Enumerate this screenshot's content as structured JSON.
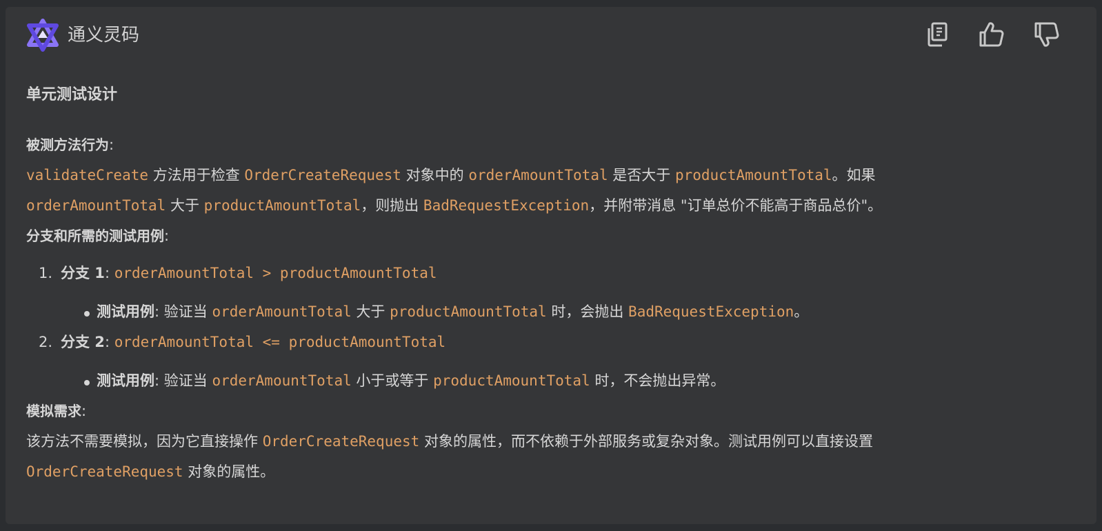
{
  "header": {
    "title": "通义灵码",
    "icons": [
      "tongyi-logo",
      "copy-icon",
      "thumbs-up-icon",
      "thumbs-down-icon"
    ]
  },
  "content": {
    "heading": "单元测试设计",
    "behavior": {
      "label": "被测方法行为",
      "colon": ":",
      "line1": {
        "c1": "validateCreate",
        "t1": " 方法用于检查 ",
        "c2": "OrderCreateRequest",
        "t2": " 对象中的 ",
        "c3": "orderAmountTotal",
        "t3": " 是否大于 ",
        "c4": "productAmountTotal",
        "t4": "。如果"
      },
      "line2": {
        "c1": "orderAmountTotal",
        "t1": " 大于 ",
        "c2": "productAmountTotal",
        "t2": "，则抛出 ",
        "c3": "BadRequestException",
        "t3": "，并附带消息 \"订单总价不能高于商品总价\"。"
      }
    },
    "branches": {
      "label": "分支和所需的测试用例",
      "colon": ":",
      "items": [
        {
          "num": "1.",
          "title": "分支 1",
          "colon": ": ",
          "expr": "orderAmountTotal > productAmountTotal",
          "case_label": "测试用例",
          "case_colon": ": ",
          "t1": "验证当 ",
          "c1": "orderAmountTotal",
          "t2": " 大于 ",
          "c2": "productAmountTotal",
          "t3": " 时，会抛出 ",
          "c3": "BadRequestException",
          "t4": "。"
        },
        {
          "num": "2.",
          "title": "分支 2",
          "colon": ": ",
          "expr": "orderAmountTotal <= productAmountTotal",
          "case_label": "测试用例",
          "case_colon": ": ",
          "t1": "验证当 ",
          "c1": "orderAmountTotal",
          "t2": " 小于或等于 ",
          "c2": "productAmountTotal",
          "t3": " 时，不会抛出异常。"
        }
      ]
    },
    "mock": {
      "label": "模拟需求",
      "colon": ":",
      "line1": {
        "t1": "该方法不需要模拟，因为它直接操作 ",
        "c1": "OrderCreateRequest",
        "t2": " 对象的属性，而不依赖于外部服务或复杂对象。测试用例可以直接设置"
      },
      "line2": {
        "c1": "OrderCreateRequest",
        "t1": " 对象的属性。"
      }
    }
  },
  "colors": {
    "panel": "#353638",
    "text": "#d6d6d6",
    "code": "#e0a064",
    "logo_accent": "#7a62f0"
  }
}
